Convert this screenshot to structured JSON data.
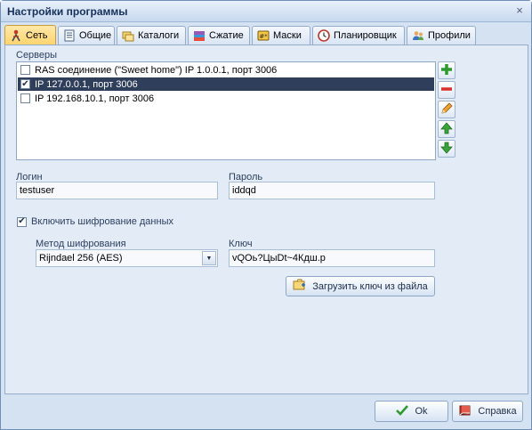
{
  "window": {
    "title": "Настройки программы",
    "close_glyph": "×"
  },
  "tabs": [
    {
      "label": "Сеть",
      "icon": "network-person-icon",
      "active": true
    },
    {
      "label": "Общие",
      "icon": "document-icon"
    },
    {
      "label": "Каталоги",
      "icon": "folders-icon"
    },
    {
      "label": "Сжатие",
      "icon": "compression-icon"
    },
    {
      "label": "Маски",
      "icon": "mask-icon"
    },
    {
      "label": "Планировщик",
      "icon": "clock-icon"
    },
    {
      "label": "Профили",
      "icon": "users-icon"
    }
  ],
  "servers": {
    "label": "Серверы",
    "items": [
      {
        "text": "RAS соединение (\"Sweet home\") IP 1.0.0.1, порт 3006",
        "checked": false
      },
      {
        "text": "IP 127.0.0.1, порт 3006",
        "checked": true,
        "selected": true
      },
      {
        "text": "IP 192.168.10.1, порт 3006",
        "checked": false
      }
    ],
    "buttons": [
      "add-icon",
      "remove-icon",
      "edit-icon",
      "move-up-icon",
      "move-down-icon"
    ]
  },
  "login": {
    "label": "Логин",
    "value": "testuser"
  },
  "password": {
    "label": "Пароль",
    "value": "iddqd"
  },
  "encryption": {
    "checkbox_label": "Включить шифрование данных",
    "checked": true,
    "method_label": "Метод шифрования",
    "method_value": "Rijndael 256 (AES)",
    "key_label": "Ключ",
    "key_value": "vQOь?ЦыDt~4Кдш.р",
    "load_key_button": "Загрузить ключ из файла"
  },
  "footer": {
    "ok_label": "Ok",
    "help_label": "Справка"
  }
}
